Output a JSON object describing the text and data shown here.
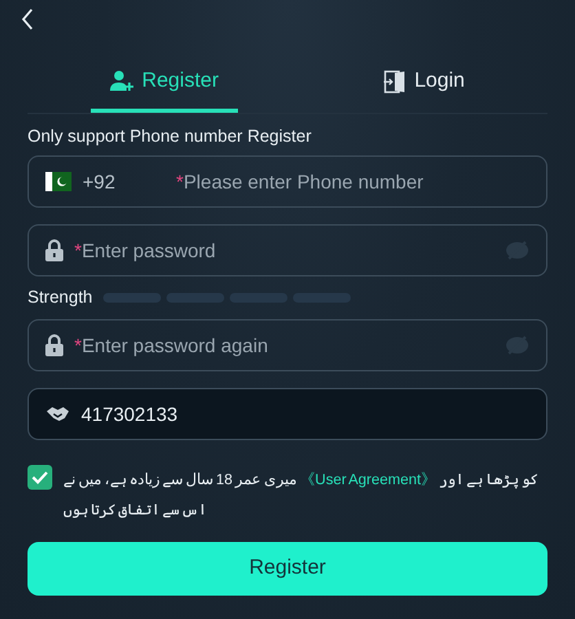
{
  "tabs": [
    {
      "label": "Register",
      "selected": true
    },
    {
      "label": "Login",
      "selected": false
    }
  ],
  "notice": "Only support Phone number Register",
  "phone": {
    "country_code": "+92",
    "required_mark": "*",
    "placeholder": "Please enter Phone number"
  },
  "password": {
    "required_mark": "*",
    "placeholder": "Enter password"
  },
  "strength": {
    "label": "Strength"
  },
  "confirm_password": {
    "required_mark": "*",
    "placeholder": "Enter password again"
  },
  "referral": {
    "value": "417302133"
  },
  "agreement": {
    "checked": true,
    "before": "میری عمر 18 سال سے زیادہ ہے، میں نے ",
    "link": "《User Agreement》",
    "after": " کو پڑھا ہے اور اس سے اتفاق کرتا ہوں"
  },
  "submit": "Register"
}
